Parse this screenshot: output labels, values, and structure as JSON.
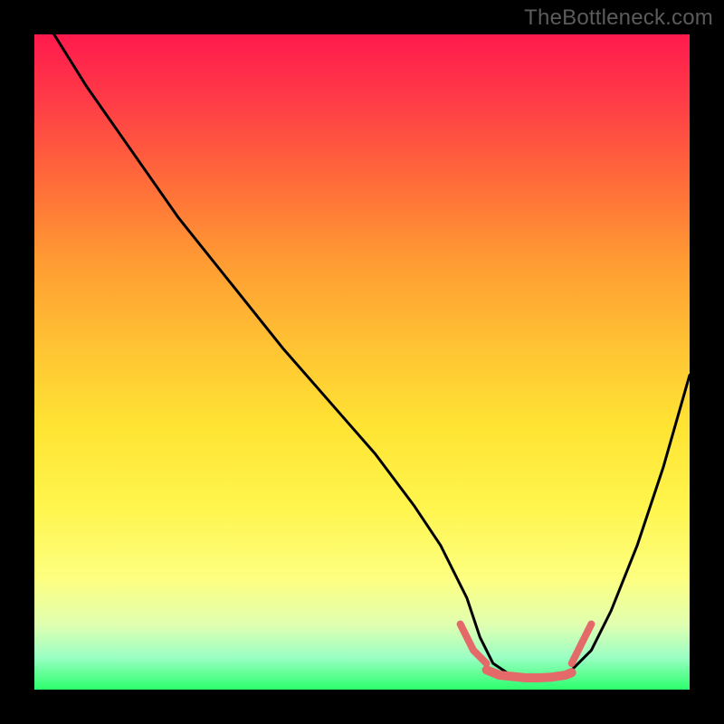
{
  "watermark": "TheBottleneck.com",
  "colors": {
    "background": "#000000",
    "gradient_top": "#ff1a4d",
    "gradient_bottom": "#2cff6d",
    "curve_main": "#000000",
    "curve_accent": "#e46a6a"
  },
  "chart_data": {
    "type": "line",
    "title": "",
    "xlabel": "",
    "ylabel": "",
    "xlim": [
      0,
      100
    ],
    "ylim": [
      0,
      100
    ],
    "annotations": [],
    "series": [
      {
        "name": "bottleneck-curve",
        "x": [
          3,
          8,
          15,
          22,
          30,
          38,
          45,
          52,
          58,
          62,
          66,
          68,
          70,
          73,
          76,
          78,
          80,
          82,
          85,
          88,
          92,
          96,
          100
        ],
        "values": [
          100,
          92,
          82,
          72,
          62,
          52,
          44,
          36,
          28,
          22,
          14,
          8,
          4,
          2,
          1.5,
          1.5,
          2,
          3,
          6,
          12,
          22,
          34,
          48
        ]
      },
      {
        "name": "accent-left-cap",
        "x": [
          65,
          66,
          67,
          68,
          69
        ],
        "values": [
          10,
          8,
          6,
          5,
          4
        ]
      },
      {
        "name": "accent-flat",
        "x": [
          69,
          71,
          73,
          75,
          77,
          79,
          81,
          82
        ],
        "values": [
          3,
          2.2,
          2,
          1.8,
          1.8,
          1.9,
          2.2,
          2.6
        ]
      },
      {
        "name": "accent-right-cap",
        "x": [
          82,
          83,
          84,
          85
        ],
        "values": [
          4,
          6,
          8,
          10
        ]
      }
    ]
  }
}
